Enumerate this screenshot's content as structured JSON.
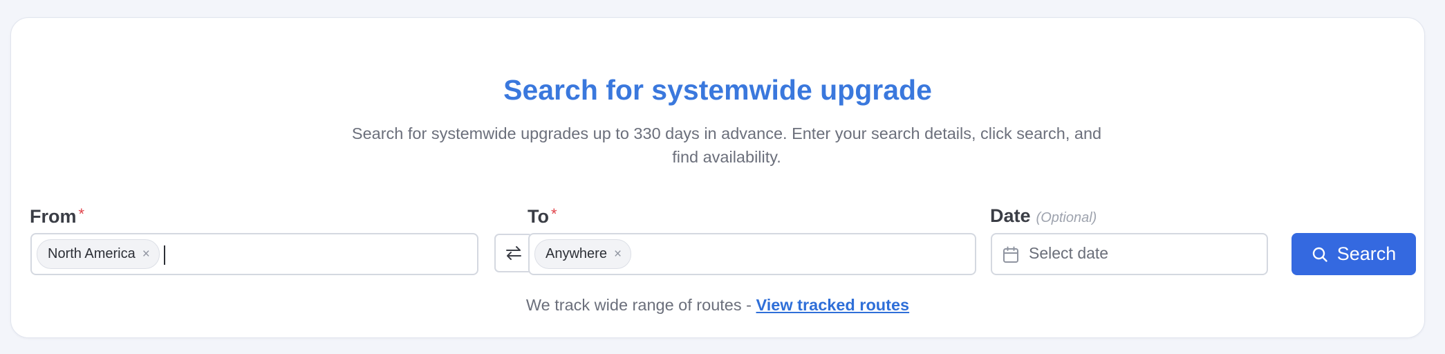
{
  "header": {
    "title": "Search for systemwide upgrade",
    "subtitle": "Search for systemwide upgrades up to 330 days in advance. Enter your search details, click search, and find availability."
  },
  "form": {
    "from": {
      "label": "From",
      "required_mark": "*",
      "chip": "North America",
      "chip_remove": "×",
      "value": ""
    },
    "swap": {
      "icon": "swap-arrows-icon"
    },
    "to": {
      "label": "To",
      "required_mark": "*",
      "chip": "Anywhere",
      "chip_remove": "×"
    },
    "date": {
      "label": "Date",
      "optional_note": "(Optional)",
      "placeholder": "Select date",
      "icon": "calendar-icon"
    },
    "search": {
      "label": "Search",
      "icon": "search-icon"
    }
  },
  "footer": {
    "text": "We track wide range of routes - ",
    "link": "View tracked routes"
  },
  "colors": {
    "accent": "#3469e0",
    "title": "#3a78dd",
    "required": "#e0434a",
    "background": "#f3f5fa"
  }
}
